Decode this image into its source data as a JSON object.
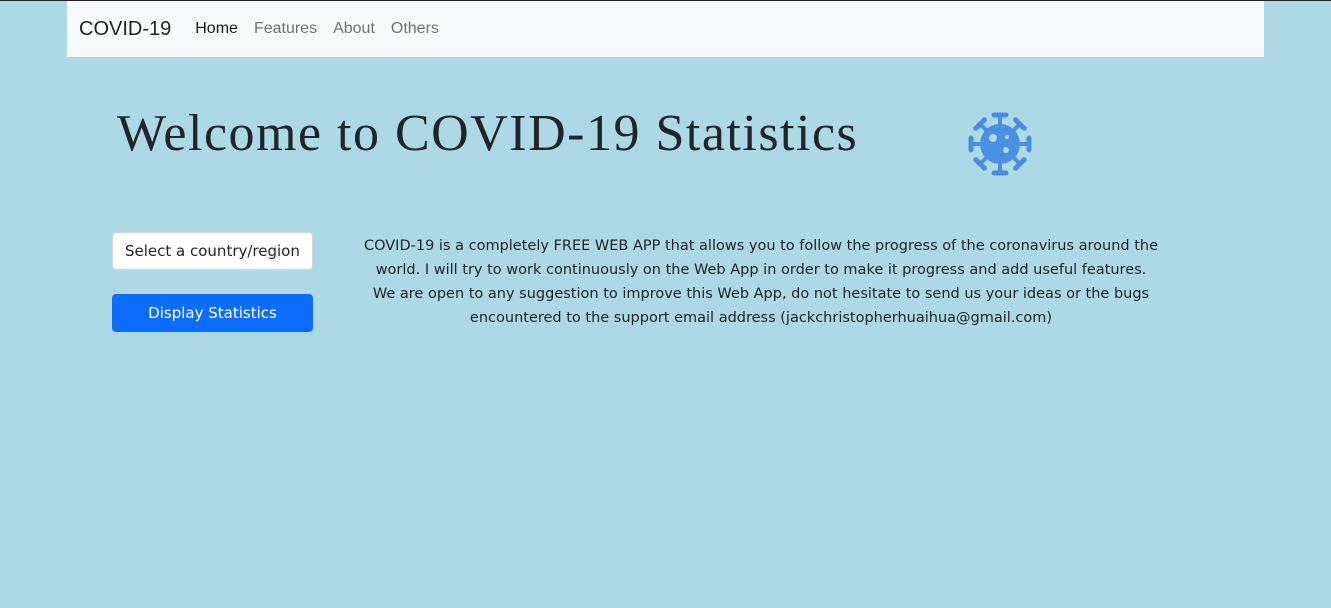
{
  "navbar": {
    "brand": "COVID-19",
    "links": [
      {
        "label": "Home",
        "active": true
      },
      {
        "label": "Features",
        "active": false
      },
      {
        "label": "About",
        "active": false
      },
      {
        "label": "Others",
        "active": false
      }
    ]
  },
  "hero": {
    "title": "Welcome to COVID-19 Statistics",
    "icon": "virus-icon",
    "icon_color": "#4a90e2"
  },
  "form": {
    "select_value": "Select a country/region",
    "button_label": "Display Statistics"
  },
  "description": {
    "line1": "COVID-19 is a completely FREE WEB APP that allows you to follow the progress of the coronavirus around the world. I will try to work continuously on the Web App in order to make it progress and add useful features.",
    "line2": "We are open to any suggestion to improve this Web App, do not hesitate to send us your ideas or the bugs encountered to the support email address (jackchristopherhuaihua@gmail.com)"
  },
  "colors": {
    "background": "#add8e6",
    "navbar": "#f8f9fa",
    "primary": "#0d6efd"
  }
}
